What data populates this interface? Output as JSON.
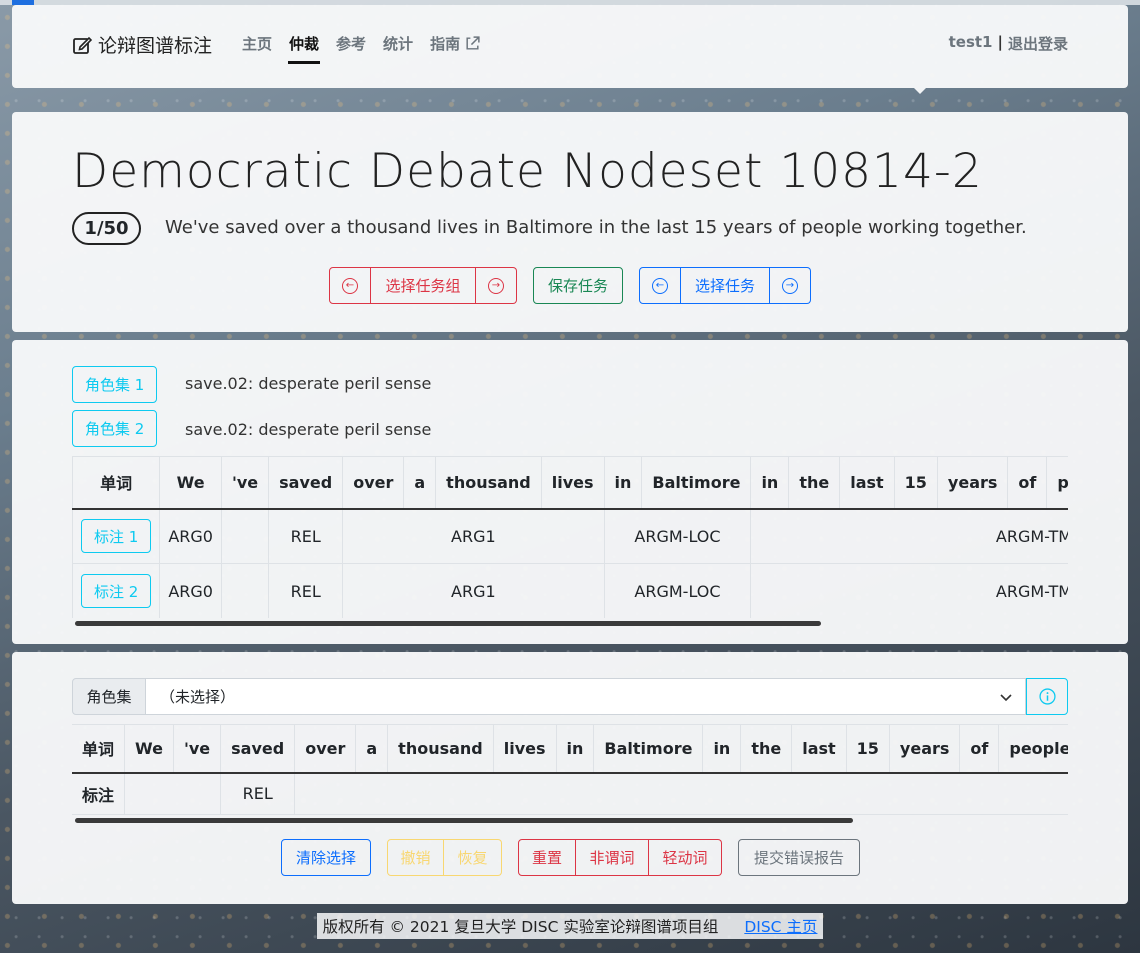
{
  "nav": {
    "brand": "论辩图谱标注",
    "links": [
      "主页",
      "仲裁",
      "参考",
      "统计",
      "指南"
    ],
    "active_index": 1,
    "user": "test1",
    "logout": "退出登录"
  },
  "header": {
    "title": "Democratic Debate Nodeset 10814-2",
    "counter": "1/50",
    "sentence": "We've saved over a thousand lives in Baltimore in the last 15 years of people working together.",
    "select_group": "选择任务组",
    "save_task": "保存任务",
    "select_task": "选择任务"
  },
  "roles": {
    "sets": [
      {
        "button": "角色集 1",
        "desc": "save.02: desperate peril sense"
      },
      {
        "button": "角色集 2",
        "desc": "save.02: desperate peril sense"
      }
    ],
    "word_header": "单词",
    "words": [
      "We",
      "'ve",
      "saved",
      "over",
      "a",
      "thousand",
      "lives",
      "in",
      "Baltimore",
      "in",
      "the",
      "last",
      "15",
      "years",
      "of",
      "pe"
    ],
    "rows": [
      {
        "button": "标注 1",
        "cells": [
          "ARG0",
          "",
          "REL",
          "ARG1",
          "ARGM-LOC",
          "ARGM-TMP"
        ]
      },
      {
        "button": "标注 2",
        "cells": [
          "ARG0",
          "",
          "REL",
          "ARG1",
          "ARGM-LOC",
          "ARGM-TMP"
        ]
      }
    ]
  },
  "editor": {
    "roleset_label": "角色集",
    "roleset_value": "（未选择）",
    "word_header": "单词",
    "label_header": "标注",
    "words": [
      "We",
      "'ve",
      "saved",
      "over",
      "a",
      "thousand",
      "lives",
      "in",
      "Baltimore",
      "in",
      "the",
      "last",
      "15",
      "years",
      "of",
      "people"
    ],
    "labels": [
      "",
      "REL",
      ""
    ],
    "buttons": {
      "clear": "清除选择",
      "undo": "撤销",
      "redo": "恢复",
      "reset": "重置",
      "non_predicate": "非谓词",
      "light_verb": "轻动词",
      "report": "提交错误报告"
    }
  },
  "footer": {
    "copyright": "版权所有 © 2021 复旦大学 DISC 实验室论辩图谱项目组",
    "link": "DISC 主页"
  },
  "colors": {
    "red": "#dc3545",
    "blue": "#0d6efd",
    "green": "#198754",
    "cyan": "#0dcaf0",
    "yellow": "#ffc107",
    "gray": "#6c757d"
  }
}
